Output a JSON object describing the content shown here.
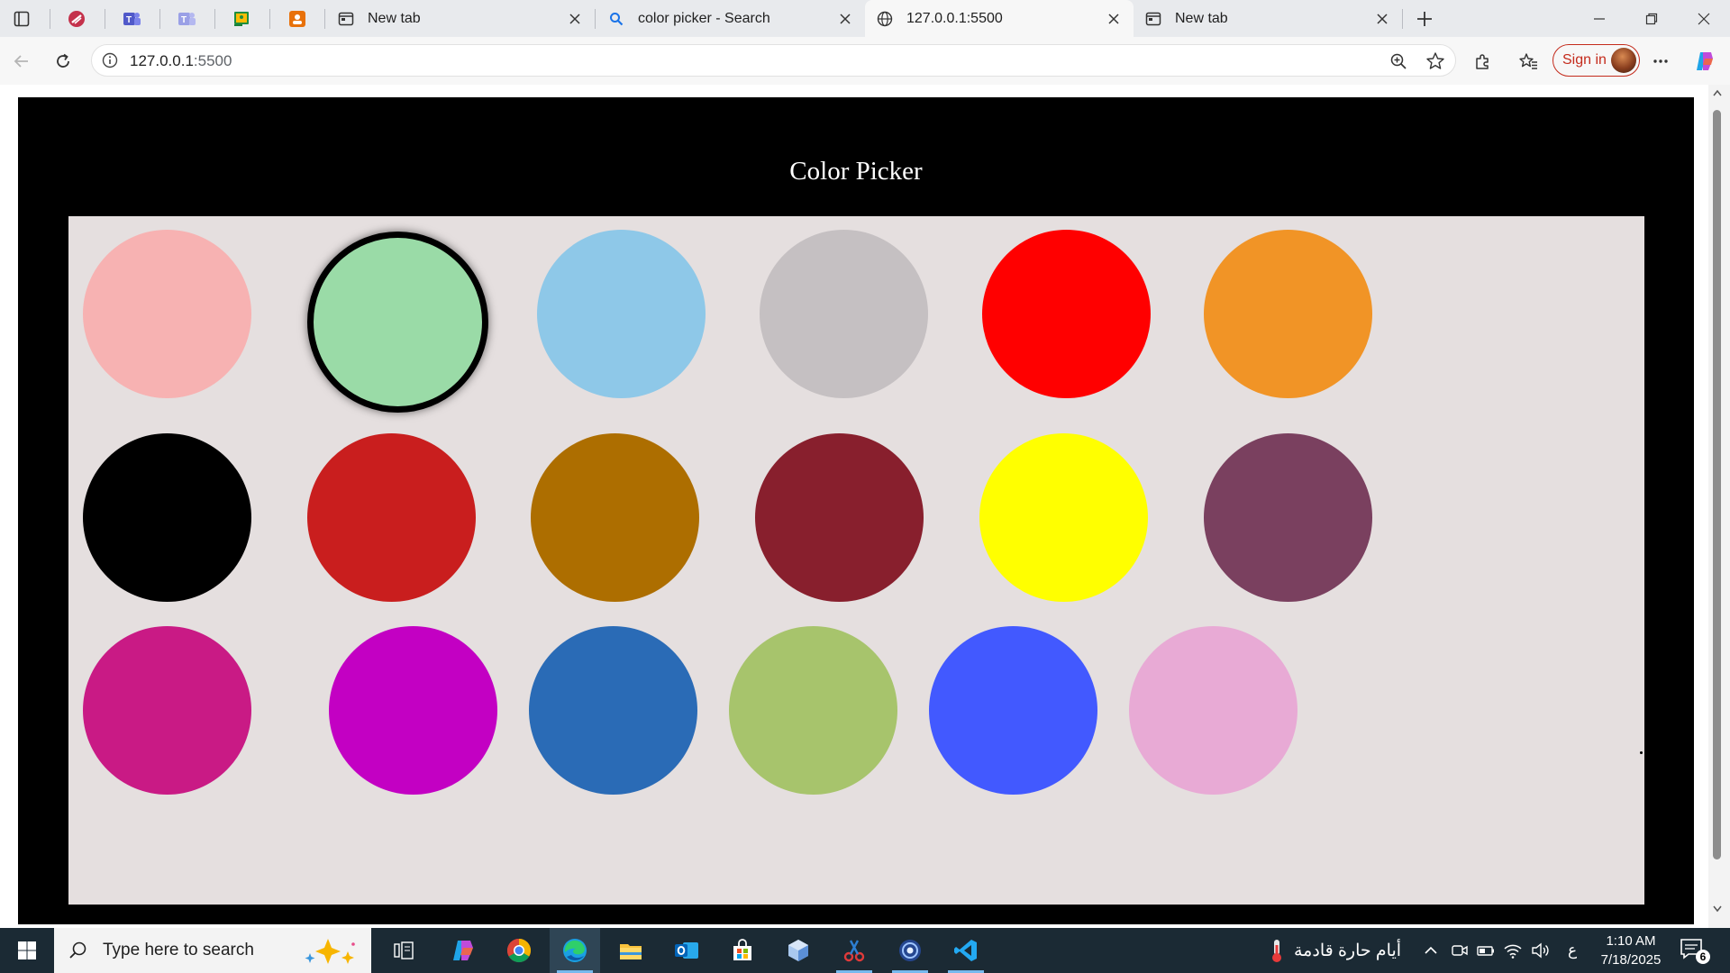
{
  "browser": {
    "tabs": [
      {
        "title": "New tab",
        "active": false,
        "favicon": "newtab-icon"
      },
      {
        "title": "color picker - Search",
        "active": false,
        "favicon": "search-icon"
      },
      {
        "title": "127.0.0.1:5500",
        "active": true,
        "favicon": "globe-icon"
      },
      {
        "title": "New tab",
        "active": false,
        "favicon": "newtab-icon"
      }
    ],
    "url_host": "127.0.0.1",
    "url_port": ":5500",
    "signin_label": "Sign in"
  },
  "page": {
    "title": "Color Picker",
    "selected_index": 1,
    "swatches": [
      {
        "color": "#f7b2b2"
      },
      {
        "color": "#9adba7"
      },
      {
        "color": "#8ec8e8"
      },
      {
        "color": "#c5c0c2"
      },
      {
        "color": "#ff0000"
      },
      {
        "color": "#f19426"
      },
      {
        "color": "#000000"
      },
      {
        "color": "#c91e1e"
      },
      {
        "color": "#ad6e00"
      },
      {
        "color": "#881f2d"
      },
      {
        "color": "#ffff00"
      },
      {
        "color": "#7a405f"
      },
      {
        "color": "#c91a85"
      },
      {
        "color": "#c300c3"
      },
      {
        "color": "#2a6bb6"
      },
      {
        "color": "#a7c46c"
      },
      {
        "color": "#4259ff"
      },
      {
        "color": "#e8aad5"
      }
    ]
  },
  "taskbar": {
    "search_placeholder": "Type here to search",
    "weather_text": "أيام حارة قادمة",
    "lang": "ع",
    "time": "1:10 AM",
    "date": "7/18/2025",
    "notification_count": "6"
  }
}
